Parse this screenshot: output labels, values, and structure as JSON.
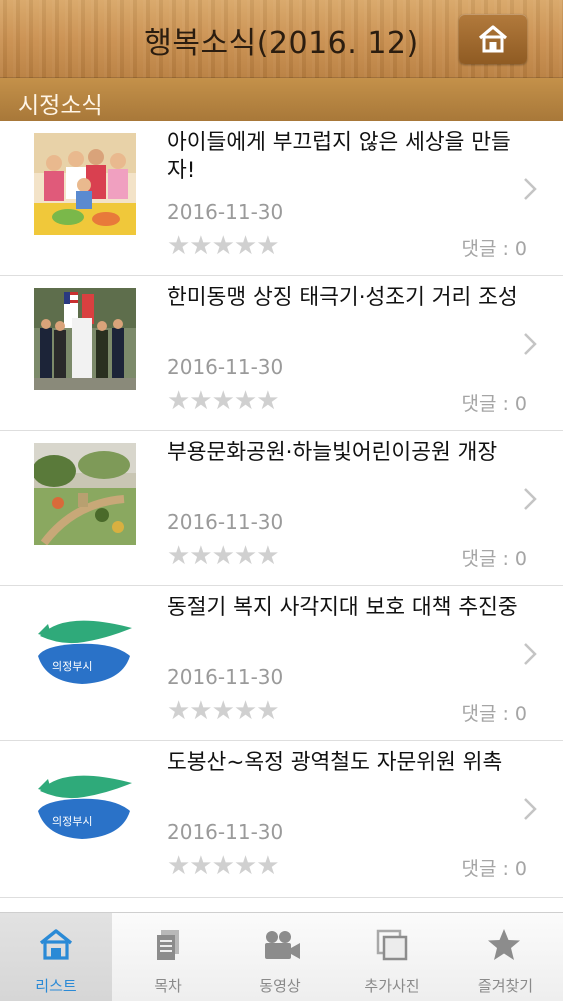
{
  "header": {
    "title": "행복소식(2016. 12)",
    "home_icon": "home-icon"
  },
  "section": {
    "title": "시정소식"
  },
  "items": [
    {
      "title": "아이들에게 부끄럽지 않은 세상을 만들자!",
      "date": "2016-11-30",
      "stars": "★★★★★",
      "rating": 0,
      "comment": "댓글 : 0",
      "thumb": "children-photo"
    },
    {
      "title": "한미동맹 상징 태극기·성조기 거리 조성",
      "date": "2016-11-30",
      "stars": "★★★★★",
      "rating": 0,
      "comment": "댓글 : 0",
      "thumb": "flag-ceremony-photo"
    },
    {
      "title": "부용문화공원·하늘빛어린이공원 개장",
      "date": "2016-11-30",
      "stars": "★★★★★",
      "rating": 0,
      "comment": "댓글 : 0",
      "thumb": "park-photo"
    },
    {
      "title": "동절기 복지 사각지대 보호 대책 추진중",
      "date": "2016-11-30",
      "stars": "★★★★★",
      "rating": 0,
      "comment": "댓글 : 0",
      "thumb": "welfare-logo",
      "logo_text": "의정부시"
    },
    {
      "title": "도봉산~옥정 광역철도 자문위원 위촉",
      "date": "2016-11-30",
      "stars": "★★★★★",
      "rating": 0,
      "comment": "댓글 : 0",
      "thumb": "welfare-logo",
      "logo_text": "의정부시"
    }
  ],
  "tabs": [
    {
      "label": "리스트",
      "icon": "home-icon",
      "active": true
    },
    {
      "label": "목차",
      "icon": "document-icon",
      "active": false
    },
    {
      "label": "동영상",
      "icon": "video-camera-icon",
      "active": false
    },
    {
      "label": "추가사진",
      "icon": "photos-icon",
      "active": false
    },
    {
      "label": "즐겨찾기",
      "icon": "star-icon",
      "active": false
    }
  ],
  "colors": {
    "accent": "#2a8ad6",
    "header_wood": "#c98f4f",
    "section_bar": "#b58343"
  }
}
